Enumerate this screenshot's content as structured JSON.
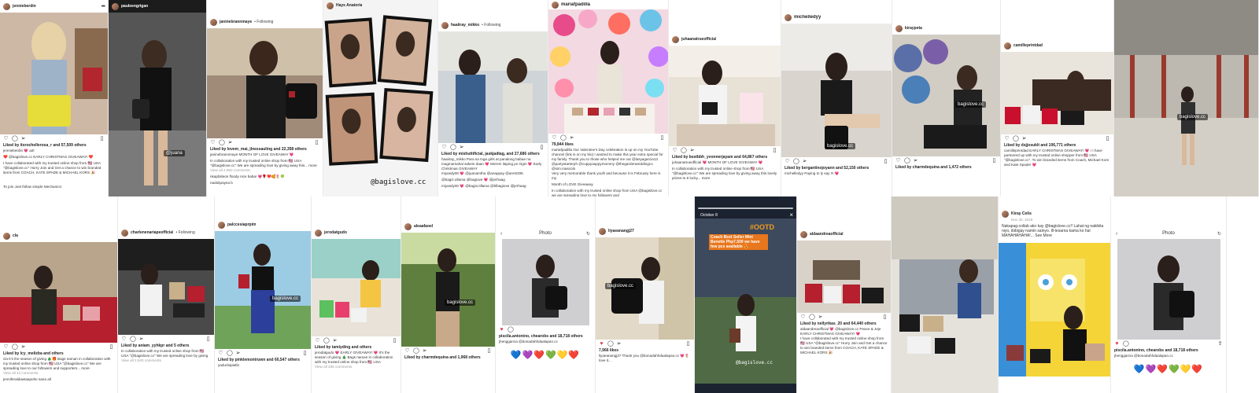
{
  "top": [
    {
      "user": "jennieberdin",
      "likes": "Liked by itsrochellerosa_r and 57,509 others",
      "caption": "jennieberdin 💗 ad!",
      "caption2": "❤️ @bagislove.cc EARLY CHRISTMAS GIVEAWAY! ❤️",
      "caption3": "I have collaborated with my trusted online shop from 🇺🇸 USA \"@bagislove.cc\" Hurry Join and Get a chance to win branded items from COACH, KATE SPADE & MICHAEL KORS 🎉",
      "caption4": "To join Just follow simple Mechanics:"
    },
    {
      "user": "pauleengrigan",
      "wm": "@juana"
    },
    {
      "user": "janinebrannmaye",
      "follow": "• Following",
      "likes": "Liked by lovem_mai, jlnessauling and 22,358 others",
      "caption": "janinebrannmaye MONTH OF LOVE GIVEAWAY 💗",
      "caption2": "In collaboration with my trusted online shop from 🇺🇸 USA \"@bagislove.cc\" We are spreading love by giving away this... more",
      "caption3": "View all 2,950 comments",
      "caption4": "nkapbiiteos floody nice baba! 💗🌹❤️🥰🌷🍀",
      "caption5": "nadoitpayea b"
    },
    {
      "user": "Hays Anatoria",
      "big": "@bagislove.cc"
    },
    {
      "user": "haaiiray_mikko",
      "follow": "• Following",
      "likes": "Liked by mishuttificial, jaskjadtag, and 27,686 others",
      "caption": "haaiiray_mikko Para sa mga girls at panalong babae na magmamahal sakein daan 💗 Merem ilaping po Ogm 💗 Early Christmas GIVEAWAY",
      "caption2": "miyasdy00 💗 @juanamtha @anappay @ann0206",
      "caption3": "@bagiz.ullama @bagiove 💗 @jerhaag",
      "caption4": "miyasdy00 💗 @bagio.tillama @blbagiove @jerhaag"
    },
    {
      "user": "mariafpadilla",
      "likes": "79,844 likes",
      "caption": "mariafpadilla Our Valentine's Day celebration is up on my YouTube channel (link is on my bio) I wanted to make this year extra special for my family. Thank you to those who helped me out @lasyagarcia13 @partystarterph @cuppyauppymommy @thegardenweddingco @sim.mascolo",
      "caption2": "Very very memorable thank youll! and because it is February here is my",
      "caption3": "Month of LOVE Giveaway",
      "caption4": "In collaboration with my trusted online shop from USA @bagislove.cc we are spreading love to my followers and"
    },
    {
      "user": "juhaanatrueofficial",
      "likes": "Liked by bestbbh_yvonnerjayam and 64,867 others",
      "caption": "juhaanatrueofficial 💗 MONTH OF LOVE GIVEAWAY 💗",
      "caption2": "In collaboration with my trusted online shop from 🇺🇸 USA \"@bagislove.cc\" We are spreading love by giving away this lovely prizes to 8 lucky... more"
    },
    {
      "user": "michelledyy",
      "wm": "bagislove.cc",
      "likes": "Liked by bergantinojoyann and 52,150 others",
      "caption": "michelledyy Paying to ly say !!! 💗"
    },
    {
      "user": "kiraypeta",
      "wm": "bagislove.cc",
      "likes": "Liked by charmdequina and 1,472 others"
    },
    {
      "user": "camilleprintdad",
      "likes": "Liked by dsjjosuklt and 106,771 others",
      "caption": "camilleprintdad EARLY CHRISTMAS GIVEAWAY! 💗 ! I have partnered up with my trusted online shopper from 🇺🇸 USA \"@bagislove.cc\". To win branded items from Coach, Michael Kors and Kate Spade! 💗"
    },
    {
      "user": "",
      "wm": "bagislove.cc"
    }
  ],
  "bottom": [
    {
      "user": "cla",
      "likes": "Liked by lcy_melizba and others",
      "caption": "cla It's the season of giving 🎄🎁 Bags naman in collaboration with my trusted online shop from 🇺🇸 USA \"@bagislove.cc\" We are spreading love to our followers and supporters... more",
      "caption2": "View all 44 comments",
      "caption3": "jenniferaldawtaapohe sana all"
    },
    {
      "user": "charlenenariapeofficial",
      "follow": "• Following",
      "likes": "Liked by aniam_yyhkpr and 5 others",
      "caption": "In collaboration with my trusted online shop from 🇺🇸 USA \"@bagislove.cc\" We are spreading love by giving away this lovely... more",
      "caption2": "View all 2,940 comments"
    },
    {
      "user": "palccesiaprpim",
      "wm": "bagislove.cc",
      "likes": "Liked by pinklemontruwn and 60,547 others",
      "caption": "yadunlapiatlo"
    },
    {
      "user": "jerodatgudo",
      "likes": "Liked by tamiyding and others",
      "caption": "jerodatgudo 💗 EARLY GIVEAWAY! 💗 It's the season of giving 🎄 Bags naman in collaboration with my trusted online shop from 🇺🇸 USA \"@bagislove.cc\" We are spreading love by giving away this... more",
      "caption2": "View all 336 comments"
    },
    {
      "user": "aleaafaoel",
      "wm": "bagislove.cc",
      "likes": "Liked by charmdequina and 1,968 others"
    },
    {
      "user": "",
      "title": "Photo",
      "likes": "piscila.antonino, chearobs and 18,718 others",
      "caption": "jhenggarcia @bonadahhdaalapan.cc",
      "emojis": "💙💜❤️💚💛❤️"
    },
    {
      "user": "liyaeanangj27",
      "wm": "bagislove.cc",
      "likes": "7,966 likes",
      "caption": "liyaeanangj27 Thank you @bonadahhdaalapan.cc 💗🌷 love it..."
    },
    {
      "user": "October 8",
      "ootd": "#OOTD",
      "promo": "Coach Best Seller Mini Benette Php7,500 we have few pcs available 😍",
      "big": "@bagislove.cc"
    },
    {
      "user": "aldaandreaofficial",
      "likes": "Liked by nellyrikas_20 and 64,440 others",
      "caption": "aldaandreaofficial 💗 @bagislove.cc Peace & Jeje EARLY CHRISTMAS GIVEAWAY! 💗",
      "caption2": "I have collaborated with my trusted online shop from 🇺🇸 USA \"@bagislove.cc\" Hurry Join and Get a chance to win branded items from COACH, KATE SPADE & MICHAEL KORS 🎉"
    },
    {
      "user": ""
    },
    {
      "user": "Kiray Celis",
      "date": "Nov 30, 2019",
      "caption": "Nakapag-collab ako kay @bagislove.cc!! Lahat ng nakikita niyo, ibibigay namin sainyo. Ill-lesarna kama ko hal MAHAHAHAHA!... See More"
    },
    {
      "user": "",
      "title": "Photo",
      "likes": "piscila.antonino, chearobs and 18,718 others",
      "caption": "jhenggarcia @bonadahhdaalapan.cc",
      "emojis": "💙💜❤️💚💛❤️"
    }
  ]
}
